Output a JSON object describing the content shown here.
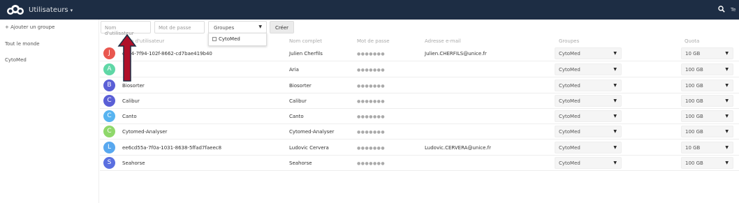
{
  "header": {
    "app_title": "Utilisateurs",
    "user_label": "Te"
  },
  "sidebar": {
    "add_group": "+ Ajouter un groupe",
    "items": [
      {
        "label": "Tout le monde"
      },
      {
        "label": "CytoMed"
      }
    ]
  },
  "form": {
    "username_placeholder": "Nom d'utilisateur",
    "password_placeholder": "Mot de passe",
    "groups_label": "Groupes",
    "create_label": "Créer",
    "dropdown_option": "CytoMed"
  },
  "table": {
    "headers": {
      "username": "Nom d'utilisateur",
      "fullname": "Nom complet",
      "password": "Mot de passe",
      "email": "Adresse e-mail",
      "groups": "Groupes",
      "quota": "Quota"
    },
    "rows": [
      {
        "initial": "J",
        "color": "#e9574f",
        "username": "c6b4-7f94-102f-8662-cd7bae419b40",
        "fullname": "Julien Cherfils",
        "password": "●●●●●●●",
        "email": "Julien.CHERFILS@unice.fr",
        "group": "CytoMed",
        "quota": "10 GB"
      },
      {
        "initial": "A",
        "color": "#5fd7a6",
        "username": "",
        "fullname": "Aria",
        "password": "●●●●●●●",
        "email": "",
        "group": "CytoMed",
        "quota": "100 GB"
      },
      {
        "initial": "B",
        "color": "#5a5fd6",
        "username": "Biosorter",
        "fullname": "Biosorter",
        "password": "●●●●●●●",
        "email": "",
        "group": "CytoMed",
        "quota": "100 GB"
      },
      {
        "initial": "C",
        "color": "#5a5fd6",
        "username": "Calibur",
        "fullname": "Calibur",
        "password": "●●●●●●●",
        "email": "",
        "group": "CytoMed",
        "quota": "100 GB"
      },
      {
        "initial": "C",
        "color": "#58b4f0",
        "username": "Canto",
        "fullname": "Canto",
        "password": "●●●●●●●",
        "email": "",
        "group": "CytoMed",
        "quota": "100 GB"
      },
      {
        "initial": "C",
        "color": "#8fd86b",
        "username": "Cytomed-Analyser",
        "fullname": "Cytomed-Analyser",
        "password": "●●●●●●●",
        "email": "",
        "group": "CytoMed",
        "quota": "100 GB"
      },
      {
        "initial": "L",
        "color": "#58a8ef",
        "username": "ee6cd55a-7f0a-1031-8638-5ffad7faeec8",
        "fullname": "Ludovic Cervera",
        "password": "●●●●●●●",
        "email": "Ludovic.CERVERA@unice.fr",
        "group": "CytoMed",
        "quota": "10 GB"
      },
      {
        "initial": "S",
        "color": "#5a6fe0",
        "username": "Seahorse",
        "fullname": "Seahorse",
        "password": "●●●●●●●",
        "email": "",
        "group": "CytoMed",
        "quota": "100 GB"
      }
    ]
  },
  "colors": {
    "topbar": "#1d2d44",
    "annotation_arrow": "#b0102a"
  },
  "icons": [
    "cloud-logo-icon",
    "search-icon",
    "chevron-down-icon",
    "annotation-arrow"
  ]
}
